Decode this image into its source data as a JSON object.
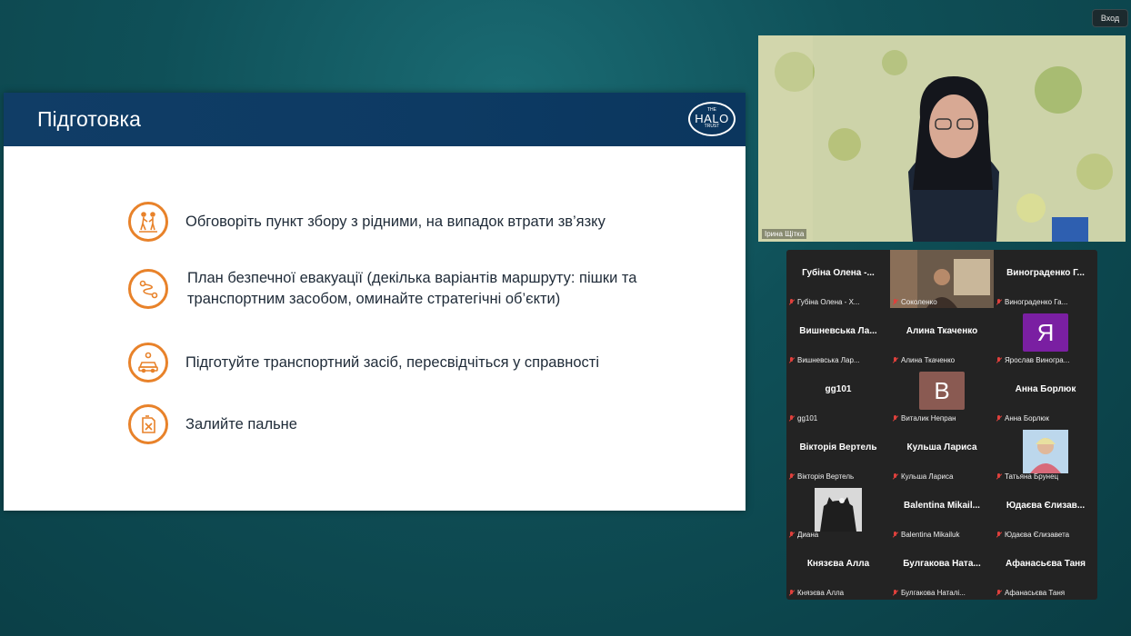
{
  "window": {
    "exit_label": "Вход"
  },
  "slide": {
    "title": "Підготовка",
    "logo": {
      "line1": "THE",
      "line2": "HALO",
      "line3": "TRUST"
    },
    "bullets": [
      {
        "icon": "family-walking-icon",
        "text": "Обговоріть пункт збору з рідними, на випадок втрати зв’язку"
      },
      {
        "icon": "route-icon",
        "text": "План безпечної евакуації (декілька варіантів маршруту: пішки та транспортним засобом, оминайте стратегічні об’єкти)"
      },
      {
        "icon": "car-check-icon",
        "text": "Підготуйте транспортний засіб, пересвідчіться у справності"
      },
      {
        "icon": "fuel-can-icon",
        "text": "Залийте пальне"
      }
    ]
  },
  "speaker": {
    "name": "Ірина Щітка"
  },
  "gallery": {
    "tiles": [
      {
        "big": "Губіна Олена -...",
        "small": "Губіна Олена - Х..."
      },
      {
        "big": "",
        "small": "Соколенко"
      },
      {
        "big": "Винограденко Г...",
        "small": "Винограденко Га..."
      },
      {
        "big": "Вишневська Ла...",
        "small": "Вишневська Лар..."
      },
      {
        "big": "Алина Ткаченко",
        "small": "Алина Ткаченко"
      },
      {
        "big": "",
        "small": "Ярослав Виногра...",
        "avatar": "Я",
        "avatar_color": "#7a1fa2"
      },
      {
        "big": "gg101",
        "small": "gg101"
      },
      {
        "big": "",
        "small": "Виталик Непран",
        "avatar": "В",
        "avatar_color": "#8a5a52"
      },
      {
        "big": "Анна Борлюк",
        "small": "Анна Борлюк"
      },
      {
        "big": "Вікторія Вертель",
        "small": "Вікторія Вертель"
      },
      {
        "big": "Кульша Лариса",
        "small": "Кульша Лариса"
      },
      {
        "big": "",
        "small": "Татьяна Брунец"
      },
      {
        "big": "",
        "small": "Диана"
      },
      {
        "big": "Balentina Mikail...",
        "small": "Balentina Mikailuk"
      },
      {
        "big": "Юдаєва Єлизав...",
        "small": "Юдаєва Єлизавета"
      },
      {
        "big": "Князєва Алла",
        "small": "Князєва Алла"
      },
      {
        "big": "Булгакова Ната...",
        "small": "Булгакова Наталі..."
      },
      {
        "big": "Афанасьєва Таня",
        "small": "Афанасьєва Таня"
      }
    ]
  },
  "colors": {
    "accent": "#e8822a",
    "header": "#0d3a63"
  }
}
